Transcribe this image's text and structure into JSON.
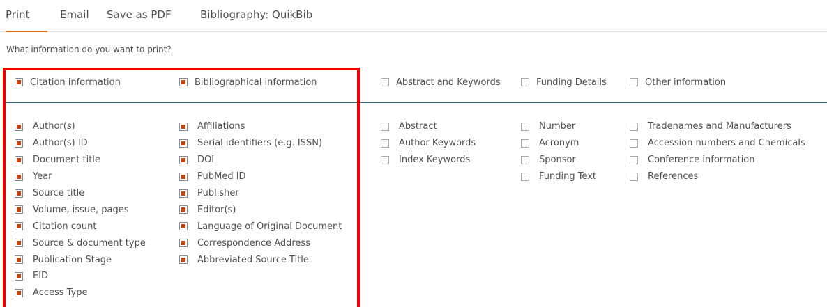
{
  "tabs": [
    {
      "label": "Print",
      "active": true
    },
    {
      "label": "Email",
      "active": false
    },
    {
      "label": "Save as PDF",
      "active": false
    },
    {
      "label": "Bibliography: QuikBib",
      "active": false
    }
  ],
  "question": "What information do you want to print?",
  "accent_color": "#e9711c",
  "checked_color": "#c1440e",
  "highlight_color": "#ee0000",
  "categories": [
    {
      "label": "Citation information",
      "checked": true
    },
    {
      "label": "Bibliographical information",
      "checked": true
    },
    {
      "label": "Abstract and Keywords",
      "checked": false
    },
    {
      "label": "Funding Details",
      "checked": false
    },
    {
      "label": "Other information",
      "checked": false
    }
  ],
  "columns": [
    {
      "items": [
        {
          "label": "Author(s)",
          "checked": true
        },
        {
          "label": "Author(s) ID",
          "checked": true
        },
        {
          "label": "Document title",
          "checked": true
        },
        {
          "label": "Year",
          "checked": true
        },
        {
          "label": "Source title",
          "checked": true
        },
        {
          "label": "Volume, issue, pages",
          "checked": true
        },
        {
          "label": "Citation count",
          "checked": true
        },
        {
          "label": "Source & document type",
          "checked": true
        },
        {
          "label": "Publication Stage",
          "checked": true
        },
        {
          "label": "EID",
          "checked": true
        },
        {
          "label": "Access Type",
          "checked": true
        }
      ]
    },
    {
      "items": [
        {
          "label": "Affiliations",
          "checked": true
        },
        {
          "label": "Serial identifiers (e.g. ISSN)",
          "checked": true
        },
        {
          "label": "DOI",
          "checked": true
        },
        {
          "label": "PubMed ID",
          "checked": true
        },
        {
          "label": "Publisher",
          "checked": true
        },
        {
          "label": "Editor(s)",
          "checked": true
        },
        {
          "label": "Language of Original Document",
          "checked": true
        },
        {
          "label": "Correspondence Address",
          "checked": true
        },
        {
          "label": "Abbreviated Source Title",
          "checked": true
        }
      ]
    },
    {
      "items": [
        {
          "label": "Abstract",
          "checked": false
        },
        {
          "label": "Author Keywords",
          "checked": false
        },
        {
          "label": "Index Keywords",
          "checked": false
        }
      ]
    },
    {
      "items": [
        {
          "label": "Number",
          "checked": false
        },
        {
          "label": "Acronym",
          "checked": false
        },
        {
          "label": "Sponsor",
          "checked": false
        },
        {
          "label": "Funding Text",
          "checked": false
        }
      ]
    },
    {
      "items": [
        {
          "label": "Tradenames and Manufacturers",
          "checked": false
        },
        {
          "label": "Accession numbers and Chemicals",
          "checked": false
        },
        {
          "label": "Conference information",
          "checked": false
        },
        {
          "label": "References",
          "checked": false
        }
      ]
    }
  ]
}
